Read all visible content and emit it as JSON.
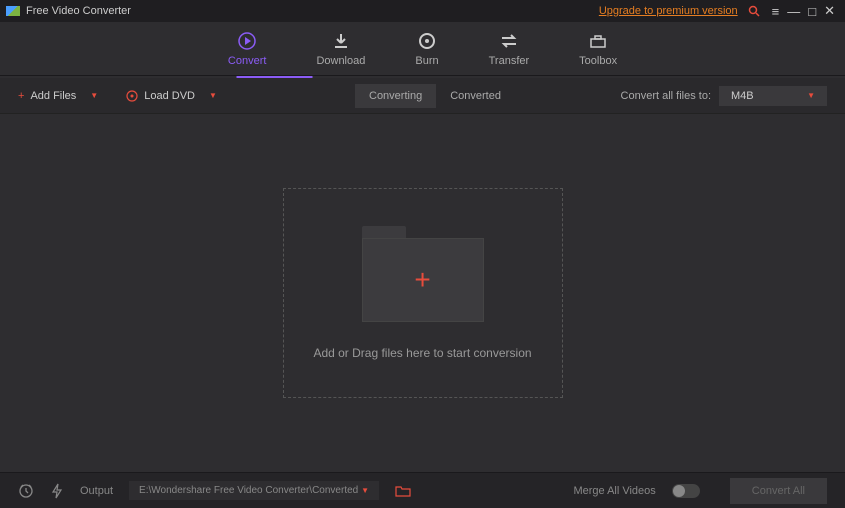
{
  "titlebar": {
    "title": "Free Video Converter",
    "upgrade": "Upgrade to premium version"
  },
  "nav": {
    "convert": "Convert",
    "download": "Download",
    "burn": "Burn",
    "transfer": "Transfer",
    "toolbox": "Toolbox"
  },
  "toolbar": {
    "add_files": "Add Files",
    "load_dvd": "Load DVD",
    "tab_converting": "Converting",
    "tab_converted": "Converted",
    "convert_all_label": "Convert all files to:",
    "format": "M4B"
  },
  "dropzone": {
    "text": "Add or Drag files here to start conversion"
  },
  "footer": {
    "output_label": "Output",
    "output_path": "E:\\Wondershare Free Video Converter\\Converted",
    "merge_label": "Merge All Videos",
    "convert_all": "Convert All"
  }
}
